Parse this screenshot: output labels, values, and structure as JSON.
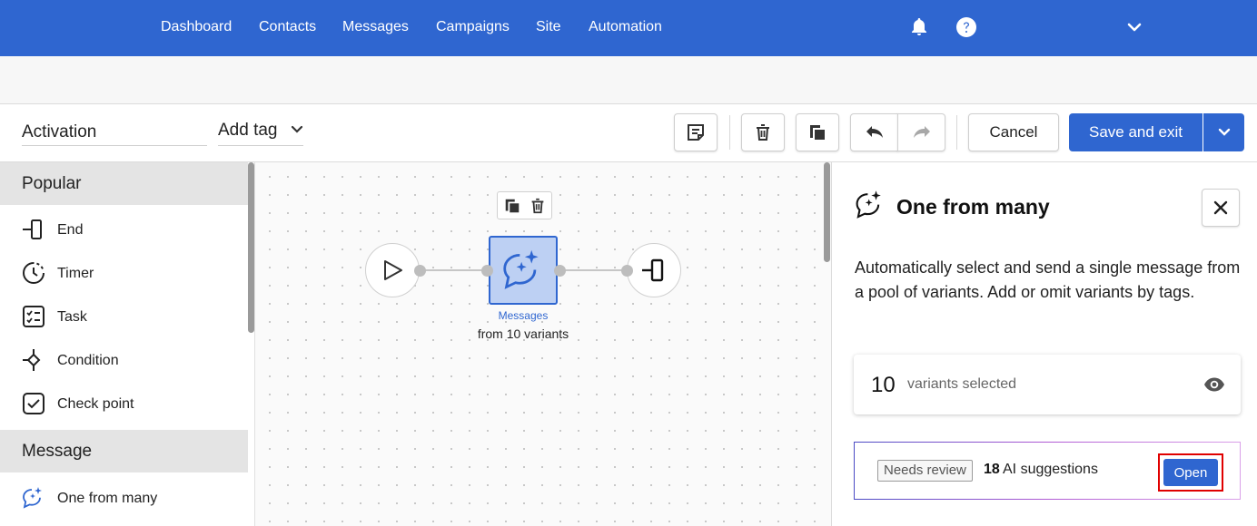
{
  "nav": {
    "items": [
      "Dashboard",
      "Contacts",
      "Messages",
      "Campaigns",
      "Site",
      "Automation"
    ],
    "bell_icon": "bell-icon",
    "help_icon": "help-icon",
    "account_menu_icon": "chevron-down-icon"
  },
  "toolbar": {
    "title_value": "Activation",
    "add_tag_label": "Add tag",
    "cancel_label": "Cancel",
    "save_label": "Save and exit"
  },
  "sidebar": {
    "sections": [
      {
        "label": "Popular",
        "items": [
          {
            "label": "End",
            "icon": "end-icon"
          },
          {
            "label": "Timer",
            "icon": "timer-icon"
          },
          {
            "label": "Task",
            "icon": "task-icon"
          },
          {
            "label": "Condition",
            "icon": "condition-icon"
          },
          {
            "label": "Check point",
            "icon": "check-point-icon"
          }
        ]
      },
      {
        "label": "Message",
        "items": [
          {
            "label": "One from many",
            "icon": "sparkle-chat-icon"
          }
        ]
      }
    ]
  },
  "canvas": {
    "node": {
      "caption_link": "Messages",
      "caption": "from 10 variants"
    }
  },
  "panel": {
    "title": "One from many",
    "description": "Automatically select and send a single message from a pool of variants. Add or omit variants by tags.",
    "variants_count": "10",
    "variants_label": "variants selected",
    "badge": "Needs review",
    "ai_count": "18",
    "ai_label": "AI suggestions",
    "open_label": "Open"
  },
  "colors": {
    "brand": "#2f66d0",
    "node_fill": "#bdd0f3",
    "highlight": "#e00000"
  }
}
